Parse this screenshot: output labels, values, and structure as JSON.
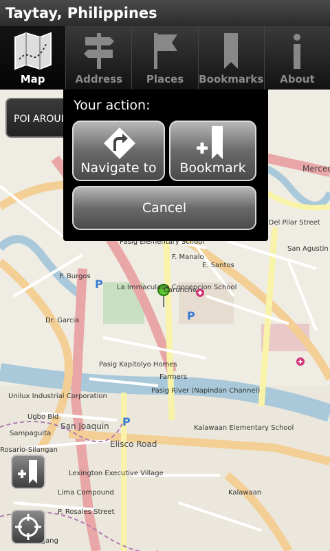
{
  "title": "Taytay, Philippines",
  "tabs": [
    {
      "label": "Map",
      "icon": "map-icon",
      "active": true
    },
    {
      "label": "Address",
      "icon": "signpost-icon",
      "active": false
    },
    {
      "label": "Places",
      "icon": "flag-icon",
      "active": false
    },
    {
      "label": "Bookmarks",
      "icon": "bookmark-icon",
      "active": false
    },
    {
      "label": "About",
      "icon": "info-icon",
      "active": false
    }
  ],
  "poi_button": "POI AROUI",
  "dialog": {
    "prompt": "Your action:",
    "navigate_label": "Navigate to",
    "bookmark_label": "Bookmark",
    "cancel_label": "Cancel"
  },
  "map_labels": [
    "Pasig Elementary School",
    "La Immaculada Concepcion School",
    "P. Burgos",
    "Dr. Garcia",
    "F. Manalo",
    "Caruncho",
    "San Joaquin",
    "Elisco Road",
    "Kalawaan Elementary School",
    "Unilux Industrial Corporation",
    "Pasig River (Napindan Channel)",
    "Pasig Kapitolyo Homes",
    "San Agustin",
    "M. H. Del Pilar Street",
    "Mercede",
    "Lexington Executive Village",
    "Lima Compound",
    "P. Rosales Street",
    "Kalawaan",
    "Malagang",
    "Sampaguita",
    "Rosario-Silangan",
    "E. Santos",
    "Farmers",
    "Ugbo Bld"
  ],
  "colors": {
    "title_bg": "#2b2b2b",
    "road_main": "#f7c8c8",
    "road_secondary": "#f4d6a0",
    "road_tertiary": "#fefeb2",
    "river": "#a8c8d8",
    "park": "#c8dfc0"
  }
}
